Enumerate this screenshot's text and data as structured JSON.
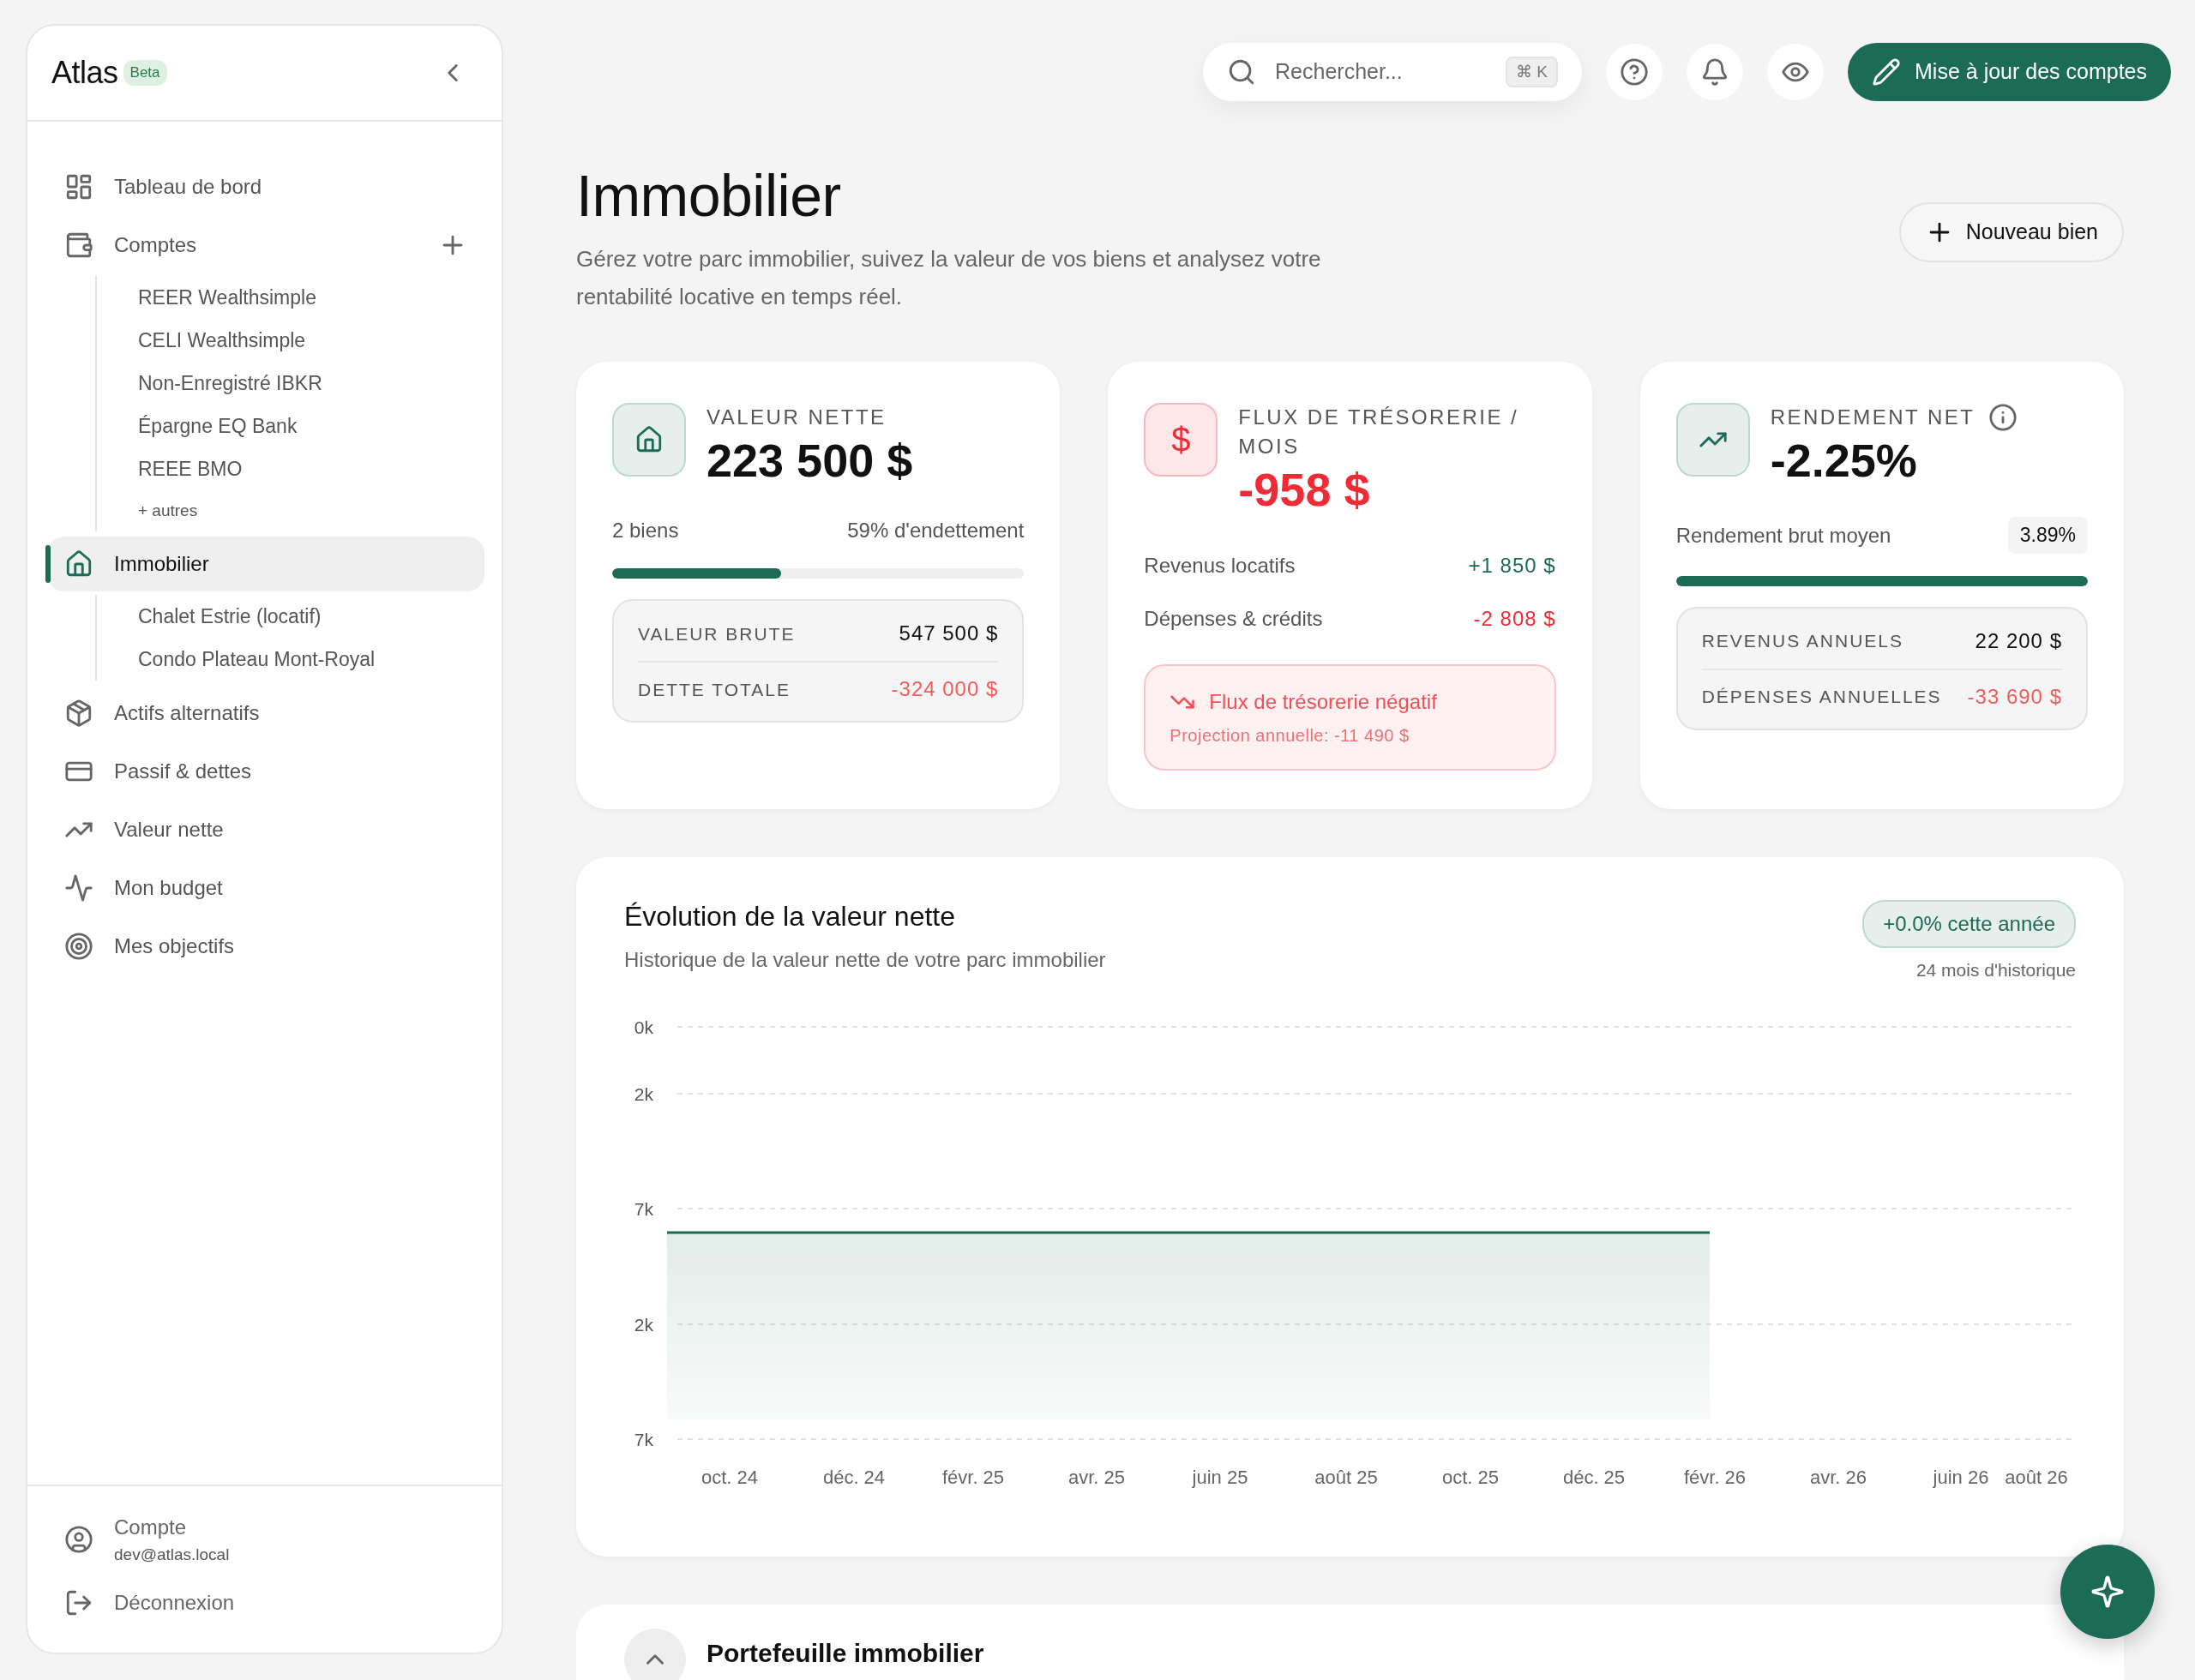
{
  "brand": {
    "name": "Atlas",
    "badge": "Beta"
  },
  "sidebar": {
    "items": [
      {
        "label": "Tableau de bord",
        "selected": false
      },
      {
        "label": "Comptes",
        "selected": false,
        "add_button": true,
        "children": [
          {
            "label": "REER Wealthsimple",
            "kind": "link"
          },
          {
            "label": "CELI Wealthsimple",
            "kind": "link"
          },
          {
            "label": "Non-Enregistré IBKR",
            "kind": "link"
          },
          {
            "label": "Épargne EQ Bank",
            "kind": "link"
          },
          {
            "label": "REEE BMO",
            "kind": "link"
          },
          {
            "label": "+ autres",
            "kind": "more"
          }
        ]
      },
      {
        "label": "Immobilier",
        "selected": true,
        "children": [
          {
            "label": "Chalet Estrie (locatif)",
            "kind": "link"
          },
          {
            "label": "Condo Plateau Mont-Royal",
            "kind": "link"
          }
        ]
      },
      {
        "label": "Actifs alternatifs",
        "selected": false
      },
      {
        "label": "Passif & dettes",
        "selected": false
      },
      {
        "label": "Valeur nette",
        "selected": false
      },
      {
        "label": "Mon budget",
        "selected": false
      },
      {
        "label": "Mes objectifs",
        "selected": false
      }
    ],
    "footer": {
      "account_label": "Compte",
      "account_email": "dev@atlas.local",
      "logout": "Déconnexion"
    }
  },
  "topbar": {
    "search": {
      "placeholder": "Rechercher...",
      "shortcut": "⌘ K"
    },
    "update_button": "Mise à jour des comptes"
  },
  "header": {
    "title": "Immobilier",
    "subtitle": "Gérez votre parc immobilier, suivez la valeur de vos biens et analysez votre rentabilité locative en temps réel.",
    "new_button": "Nouveau bien"
  },
  "cards": [
    {
      "kind": "net_value",
      "label": "VALEUR NETTE",
      "value": "223 500 $",
      "color": "#111111",
      "left_text": "2 biens",
      "right_text": "59% d'endettement",
      "level": 0.41,
      "breakdown": [
        {
          "label": "VALEUR BRUTE",
          "value": "547 500 $",
          "color": "#111111"
        },
        {
          "label": "DETTE TOTALE",
          "value": "-324 000 $",
          "color": "#f25c5c"
        }
      ]
    },
    {
      "kind": "cashflow",
      "icon_text": "$",
      "label": "FLUX DE TRÉSORERIE / MOIS",
      "value": "-958 $",
      "color": "#ef2b36",
      "rows": [
        {
          "label": "Revenus locatifs",
          "value": "+1 850 $",
          "color": "#1b6b55"
        },
        {
          "label": "Dépenses & crédits",
          "value": "-2 808 $",
          "color": "#ef2b36"
        }
      ],
      "alert": {
        "title": "Flux de trésorerie négatif",
        "detail": "Projection annuelle: -11 490 $"
      }
    },
    {
      "kind": "yield",
      "label": "RENDEMENT NET",
      "value": "-2.25%",
      "color": "#111111",
      "sub_label": "Rendement brut moyen",
      "sub_value": "3.89%",
      "level": 1,
      "breakdown": [
        {
          "label": "REVENUS ANNUELS",
          "value": "22 200 $",
          "color": "#111111"
        },
        {
          "label": "DÉPENSES ANNUELLES",
          "value": "-33 690 $",
          "color": "#f25c5c"
        }
      ]
    }
  ],
  "chart_card": {
    "title": "Évolution de la valeur nette",
    "subtitle": "Historique de la valeur nette de votre parc immobilier",
    "badge": "+0.0% cette année",
    "note": "24 mois d'historique",
    "y_labels": [
      "0k",
      "2k",
      "7k",
      "2k",
      "7k"
    ],
    "x_labels": [
      "oct. 24",
      "déc. 24",
      "févr. 25",
      "avr. 25",
      "juin 25",
      "août 25",
      "oct. 25",
      "déc. 25",
      "févr. 26",
      "avr. 26",
      "juin 26",
      "août 26"
    ]
  },
  "portfolio": {
    "title": "Portefeuille immobilier"
  }
}
